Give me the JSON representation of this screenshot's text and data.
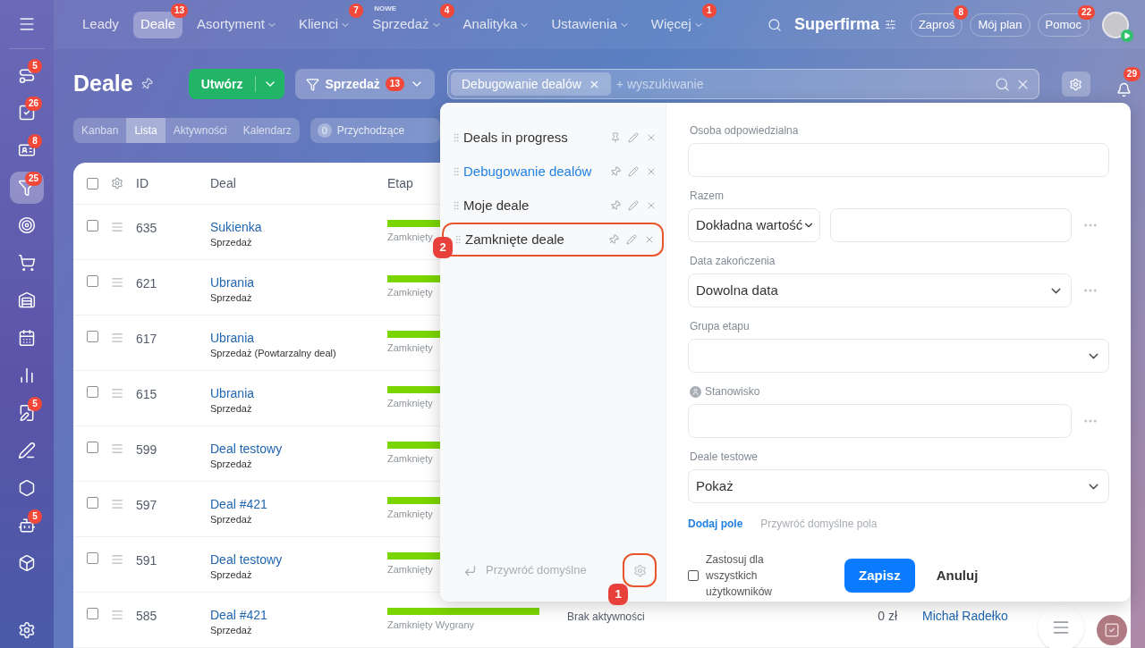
{
  "sidebar": {
    "items": [
      {
        "badge": "5",
        "selected": false
      },
      {
        "badge": "26",
        "selected": false
      },
      {
        "badge": "8",
        "selected": false
      },
      {
        "badge": "25",
        "selected": true
      },
      {
        "selected": false
      },
      {
        "selected": false
      },
      {
        "selected": false
      },
      {
        "selected": false
      },
      {
        "selected": false
      },
      {
        "badge": "5",
        "selected": false
      },
      {
        "selected": false
      },
      {
        "selected": false
      },
      {
        "badge": "5",
        "selected": false
      },
      {
        "selected": false
      }
    ]
  },
  "topnav": {
    "items": [
      {
        "label": "Leady",
        "selected": false,
        "menu": false
      },
      {
        "label": "Deale",
        "selected": true,
        "menu": false,
        "badge": "13"
      },
      {
        "label": "Asortyment",
        "selected": false,
        "menu": true
      },
      {
        "label": "Klienci",
        "selected": false,
        "menu": true,
        "badge": "7"
      },
      {
        "label": "Sprzedaż",
        "selected": false,
        "menu": true,
        "badge": "4",
        "tag": "NOWE"
      },
      {
        "label": "Analityka",
        "selected": false,
        "menu": true
      },
      {
        "label": "Ustawienia",
        "selected": false,
        "menu": true
      },
      {
        "label": "Więcej",
        "selected": false,
        "menu": true,
        "badge": "1"
      }
    ],
    "company": "Superfirma",
    "buttons": [
      {
        "label": "Zaproś",
        "badge": "8"
      },
      {
        "label": "Mój plan"
      },
      {
        "label": "Pomoc",
        "badge": "22"
      }
    ]
  },
  "header": {
    "title": "Deale",
    "create_button": "Utwórz",
    "pipeline": {
      "label": "Sprzedaż",
      "badge": "13"
    },
    "search": {
      "chip": "Debugowanie dealów",
      "placeholder": "+ wyszukiwanie"
    },
    "notifications_badge": "29"
  },
  "view_tabs": [
    {
      "label": "Kanban",
      "selected": false
    },
    {
      "label": "Lista",
      "selected": true
    },
    {
      "label": "Aktywności",
      "selected": false
    },
    {
      "label": "Kalendarz",
      "selected": false
    }
  ],
  "incoming": {
    "count": "0",
    "label": "Przychodzące"
  },
  "table": {
    "all_checked": false,
    "columns": [
      "ID",
      "Deal",
      "Etap"
    ],
    "rows": [
      {
        "id": "635",
        "deal": "Sukienka",
        "pipeline": "Sprzedaż",
        "stage": "Zamknięty",
        "level": 1,
        "checked": false
      },
      {
        "id": "621",
        "deal": "Ubrania",
        "pipeline": "Sprzedaż",
        "stage": "Zamknięty",
        "level": 1,
        "checked": false
      },
      {
        "id": "617",
        "deal": "Ubrania",
        "pipeline": "Sprzedaż (Powtarzalny deal)",
        "stage": "Zamknięty",
        "level": 1,
        "checked": false
      },
      {
        "id": "615",
        "deal": "Ubrania",
        "pipeline": "Sprzedaż",
        "stage": "Zamknięty",
        "level": 1,
        "checked": false
      },
      {
        "id": "599",
        "deal": "Deal testowy",
        "pipeline": "Sprzedaż",
        "stage": "Zamknięty",
        "level": 1,
        "checked": false
      },
      {
        "id": "597",
        "deal": "Deal #421",
        "pipeline": "Sprzedaż",
        "stage": "Zamknięty",
        "level": 1,
        "checked": false
      },
      {
        "id": "591",
        "deal": "Deal testowy",
        "pipeline": "Sprzedaż",
        "stage": "Zamknięty",
        "level": 1,
        "checked": false
      },
      {
        "id": "585",
        "deal": "Deal #421",
        "pipeline": "Sprzedaż",
        "stage": "Zamknięty Wygrany",
        "level": 1,
        "activity": "Brak aktywności",
        "sum": "0 zł",
        "responsible": "Michał Radełko",
        "checked": false
      }
    ]
  },
  "filter_popup": {
    "presets": [
      {
        "label": "Deals in progress",
        "selected": false,
        "pinned": true
      },
      {
        "label": "Debugowanie dealów",
        "selected": true,
        "pinned": false
      },
      {
        "label": "Moje deale",
        "selected": false,
        "pinned": false
      },
      {
        "label": "Zamknięte deale",
        "selected": false,
        "pinned": false,
        "callout": "2"
      }
    ],
    "restore_defaults": "Przywróć domyślne",
    "settings_callout": "1",
    "fields": [
      {
        "kind": "input",
        "label": "Osoba odpowiedzialna",
        "more": false,
        "user_icon": false
      },
      {
        "kind": "range",
        "label": "Razem",
        "value": "Dokładna wartość",
        "more": true,
        "user_icon": false
      },
      {
        "kind": "select",
        "label": "Data zakończenia",
        "value": "Dowolna data",
        "more": true,
        "user_icon": false
      },
      {
        "kind": "select",
        "label": "Grupa etapu",
        "more": false,
        "user_icon": false
      },
      {
        "kind": "input",
        "label": "Stanowisko",
        "more": true,
        "user_icon": true
      },
      {
        "kind": "select",
        "label": "Deale testowe",
        "value": "Pokaż",
        "more": false,
        "user_icon": false
      }
    ],
    "add_field": "Dodaj pole",
    "restore_fields": "Przywróć domyślne pola",
    "apply_all": {
      "label": "Zastosuj dla wszystkich użytkowników",
      "checked": false
    },
    "save": "Zapisz",
    "cancel": "Anuluj"
  }
}
